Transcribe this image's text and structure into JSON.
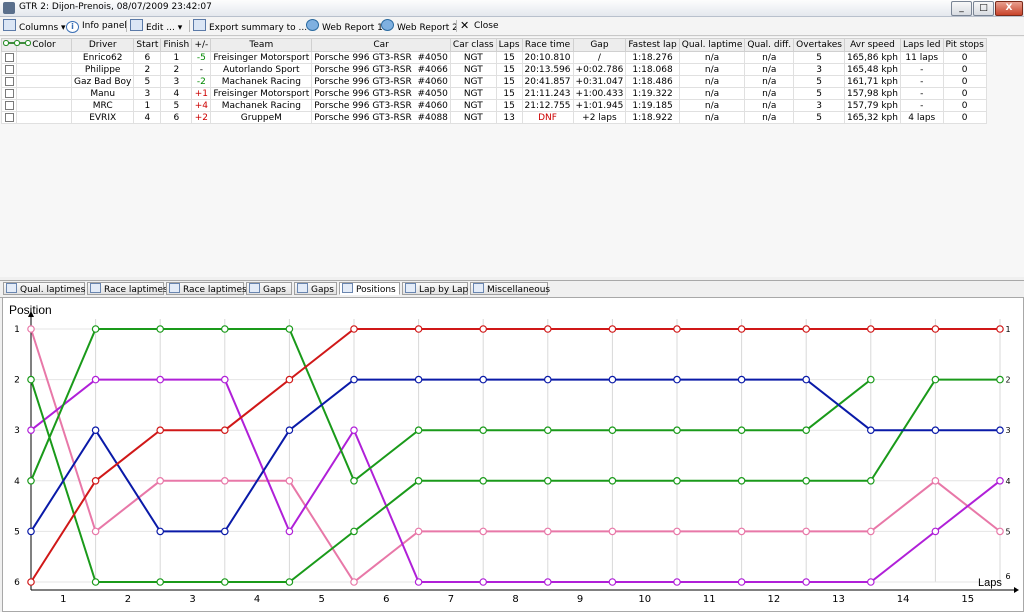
{
  "window": {
    "title": "GTR 2: Dijon-Prenois, 08/07/2009 23:42:07",
    "min": "_",
    "max": "□",
    "close": "X"
  },
  "toolbar": {
    "columns": "Columns",
    "info": "Info panel",
    "edit": "Edit ...",
    "export": "Export summary to ...",
    "web1": "Web Report 1",
    "web2": "Web Report 2",
    "close": "Close"
  },
  "table": {
    "headers": [
      "Color",
      "Driver",
      "Start",
      "Finish",
      "+/-",
      "Team",
      "Car",
      "Car class",
      "Laps",
      "Race time",
      "Gap",
      "Fastest lap",
      "Qual. laptime",
      "Qual. diff.",
      "Overtakes",
      "Avr speed",
      "Laps led",
      "Pit stops"
    ],
    "rows": [
      {
        "color": "#d01818",
        "driver": "Enrico62",
        "start": "6",
        "finish": "1",
        "diff": "-5",
        "team": "Freisinger Motorsport",
        "car": "Porsche 996 GT3-RSR",
        "num": "#4050",
        "cls": "NGT",
        "laps": "15",
        "time": "20:10.810",
        "gap": "/",
        "fastest": "1:18.276",
        "qual": "n/a",
        "qdiff": "n/a",
        "overtakes": "5",
        "speed": "165,86 kph",
        "led": "11 laps",
        "pits": "0"
      },
      {
        "color": "#1a9a1a",
        "driver": "Philippe",
        "start": "2",
        "finish": "2",
        "diff": "-",
        "team": "Autorlando Sport",
        "car": "Porsche 996 GT3-RSR",
        "num": "#4066",
        "cls": "NGT",
        "laps": "15",
        "time": "20:13.596",
        "gap": "+0:02.786",
        "fastest": "1:18.068",
        "qual": "n/a",
        "qdiff": "n/a",
        "overtakes": "3",
        "speed": "165,48 kph",
        "led": "-",
        "pits": "0"
      },
      {
        "color": "#0a1aa8",
        "driver": "Gaz Bad Boy",
        "start": "5",
        "finish": "3",
        "diff": "-2",
        "team": "Machanek Racing",
        "car": "Porsche 996 GT3-RSR",
        "num": "#4060",
        "cls": "NGT",
        "laps": "15",
        "time": "20:41.857",
        "gap": "+0:31.047",
        "fastest": "1:18.486",
        "qual": "n/a",
        "qdiff": "n/a",
        "overtakes": "5",
        "speed": "161,71 kph",
        "led": "-",
        "pits": "0"
      },
      {
        "color": "#b020d8",
        "driver": "Manu",
        "start": "3",
        "finish": "4",
        "diff": "+1",
        "team": "Freisinger Motorsport",
        "car": "Porsche 996 GT3-RSR",
        "num": "#4050",
        "cls": "NGT",
        "laps": "15",
        "time": "21:11.243",
        "gap": "+1:00.433",
        "fastest": "1:19.322",
        "qual": "n/a",
        "qdiff": "n/a",
        "overtakes": "5",
        "speed": "157,98 kph",
        "led": "-",
        "pits": "0"
      },
      {
        "color": "#e878a8",
        "driver": "MRC",
        "start": "1",
        "finish": "5",
        "diff": "+4",
        "team": "Machanek Racing",
        "car": "Porsche 996 GT3-RSR",
        "num": "#4060",
        "cls": "NGT",
        "laps": "15",
        "time": "21:12.755",
        "gap": "+1:01.945",
        "fastest": "1:19.185",
        "qual": "n/a",
        "qdiff": "n/a",
        "overtakes": "3",
        "speed": "157,79 kph",
        "led": "-",
        "pits": "0"
      },
      {
        "color": "#1a9a1a",
        "driver": "EVRIX",
        "start": "4",
        "finish": "6",
        "diff": "+2",
        "team": "GruppeM",
        "car": "Porsche 996 GT3-RSR",
        "num": "#4088",
        "cls": "NGT",
        "laps": "13",
        "time": "DNF",
        "gap": "+2 laps",
        "fastest": "1:18.922",
        "qual": "n/a",
        "qdiff": "n/a",
        "overtakes": "5",
        "speed": "165,32 kph",
        "led": "4 laps",
        "pits": "0"
      }
    ]
  },
  "tabs": [
    {
      "label": "Qual. laptimes",
      "icon": "table-icon"
    },
    {
      "label": "Race laptimes",
      "icon": "table-icon"
    },
    {
      "label": "Race laptimes",
      "icon": "chart-icon"
    },
    {
      "label": "Gaps",
      "icon": "table-icon"
    },
    {
      "label": "Gaps",
      "icon": "chart-icon"
    },
    {
      "label": "Positions",
      "icon": "chart-icon",
      "active": true
    },
    {
      "label": "Lap by Lap",
      "icon": "list-icon"
    },
    {
      "label": "Miscellaneous",
      "icon": "table-icon"
    }
  ],
  "chart_data": {
    "type": "line",
    "ylabel": "Position",
    "xlabel": "Laps",
    "x": [
      0,
      1,
      2,
      3,
      4,
      5,
      6,
      7,
      8,
      9,
      10,
      11,
      12,
      13,
      14,
      15
    ],
    "x_ticks": [
      "1",
      "2",
      "3",
      "4",
      "5",
      "6",
      "7",
      "8",
      "9",
      "10",
      "11",
      "12",
      "13",
      "14",
      "15"
    ],
    "y_ticks": [
      "1",
      "2",
      "3",
      "4",
      "5",
      "6"
    ],
    "right_ticks": [
      "1",
      "2",
      "3",
      "4",
      "5",
      "6"
    ],
    "ylim": [
      1,
      6
    ],
    "grid": true,
    "series": [
      {
        "color": "#d01818",
        "values": [
          6,
          4,
          3,
          3,
          2,
          1,
          1,
          1,
          1,
          1,
          1,
          1,
          1,
          1,
          1,
          1
        ]
      },
      {
        "color": "#1a9a1a",
        "values": [
          4,
          1,
          1,
          1,
          1,
          4,
          3,
          3,
          3,
          3,
          3,
          3,
          3,
          2,
          null,
          null
        ]
      },
      {
        "color": "#0a1aa8",
        "values": [
          5,
          3,
          5,
          5,
          3,
          2,
          2,
          2,
          2,
          2,
          2,
          2,
          2,
          3,
          3,
          3
        ]
      },
      {
        "color": "#b020d8",
        "values": [
          3,
          2,
          2,
          2,
          5,
          3,
          6,
          6,
          6,
          6,
          6,
          6,
          6,
          6,
          5,
          4
        ]
      },
      {
        "color": "#e878a8",
        "values": [
          1,
          5,
          4,
          4,
          4,
          6,
          5,
          5,
          5,
          5,
          5,
          5,
          5,
          5,
          4,
          5
        ]
      },
      {
        "color": "#1a9a1a",
        "values": [
          2,
          6,
          6,
          6,
          6,
          5,
          4,
          4,
          4,
          4,
          4,
          4,
          4,
          4,
          2,
          2
        ]
      }
    ]
  }
}
